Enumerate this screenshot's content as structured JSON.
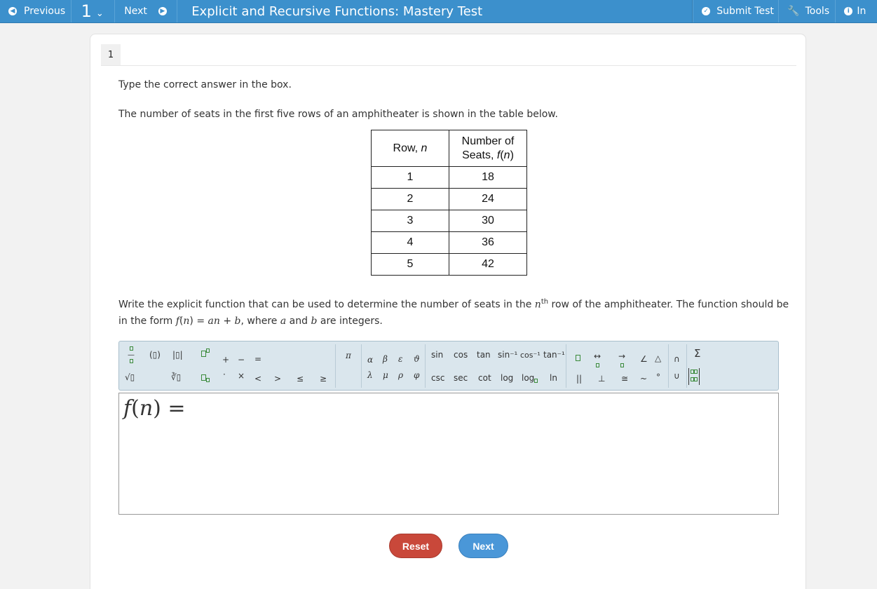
{
  "topbar": {
    "previous_label": "Previous",
    "question_number": "1",
    "next_label": "Next",
    "title": "Explicit and Recursive Functions: Mastery Test",
    "submit_label": "Submit Test",
    "tools_label": "Tools",
    "info_label": "In"
  },
  "question": {
    "number": "1",
    "instruction": "Type the correct answer in the box.",
    "intro": "The number of seats in the first five rows of an amphitheater is shown in the table below.",
    "table": {
      "header_row_prefix": "Row, ",
      "header_row_var": "n",
      "header_seats_line1": "Number of",
      "header_seats_line2_prefix": "Seats, ",
      "header_seats_f": "f",
      "header_seats_open": "(",
      "header_seats_n": "n",
      "header_seats_close": ")",
      "rows": [
        {
          "n": "1",
          "f": "18"
        },
        {
          "n": "2",
          "f": "24"
        },
        {
          "n": "3",
          "f": "30"
        },
        {
          "n": "4",
          "f": "36"
        },
        {
          "n": "5",
          "f": "42"
        }
      ]
    },
    "prompt_part1": "Write the explicit function that can be used to determine the number of seats in the ",
    "prompt_n": "n",
    "prompt_th": "th",
    "prompt_part2": " row of the amphitheater. The function should be in the form ",
    "prompt_form_f": "f",
    "prompt_form_open": "(",
    "prompt_form_n": "n",
    "prompt_form_mid": ") = ",
    "prompt_form_an": "an",
    "prompt_form_plus": " + ",
    "prompt_form_b": "b",
    "prompt_part3": ", where ",
    "prompt_a": "a",
    "prompt_and": " and ",
    "prompt_b": "b",
    "prompt_part4": " are integers."
  },
  "toolbar": {
    "paren": "(▯)",
    "abs": "|▯|",
    "plus": "+",
    "minus": "−",
    "equals": "=",
    "dot": "·",
    "times": "×",
    "lt": "<",
    "gt": ">",
    "le": "≤",
    "ge": "≥",
    "sqrt": "√▯",
    "nroot": "∛▯",
    "pi": "π",
    "alpha": "α",
    "beta": "β",
    "epsilon": "ε",
    "theta": "ϑ",
    "lambda": "λ",
    "mu": "μ",
    "rho": "ρ",
    "phi": "φ",
    "sin": "sin",
    "cos": "cos",
    "tan": "tan",
    "arcsin": "sin⁻¹",
    "arccos": "cos⁻¹",
    "arctan": "tan⁻¹",
    "csc": "csc",
    "sec": "sec",
    "cot": "cot",
    "log": "log",
    "logb": "log",
    "ln": "ln",
    "parallel": "||",
    "perp": "⊥",
    "congruent": "≅",
    "similar": "~",
    "degree": "°",
    "angle": "∠",
    "triangle": "△",
    "line": "↔",
    "ray": "→",
    "intersect": "∩",
    "union": "∪",
    "sigma": "Σ"
  },
  "answer": {
    "f": "f",
    "open": "(",
    "n": "n",
    "close_eq": ") ="
  },
  "buttons": {
    "reset": "Reset",
    "next": "Next"
  }
}
